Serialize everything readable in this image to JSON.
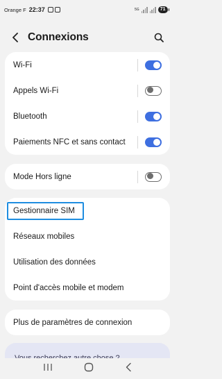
{
  "status_bar": {
    "carrier": "Orange F",
    "time": "22:37",
    "battery": "71",
    "network": "5G"
  },
  "header": {
    "title": "Connexions",
    "back_icon": "chevron-left-icon",
    "search_icon": "search-icon"
  },
  "group1": [
    {
      "label": "Wi-Fi",
      "toggle": "on"
    },
    {
      "label": "Appels Wi-Fi",
      "toggle": "off"
    },
    {
      "label": "Bluetooth",
      "toggle": "on"
    },
    {
      "label": "Paiements NFC et sans contact",
      "toggle": "on"
    }
  ],
  "group2": [
    {
      "label": "Mode Hors ligne",
      "toggle": "off"
    }
  ],
  "group3": [
    {
      "label": "Gestionnaire SIM"
    },
    {
      "label": "Réseaux mobiles"
    },
    {
      "label": "Utilisation des données"
    },
    {
      "label": "Point d'accès mobile et modem"
    }
  ],
  "group4": [
    {
      "label": "Plus de paramètres de connexion"
    }
  ],
  "partial_card": {
    "text": "Vous recherchez autre chose ?"
  },
  "nav_bar": {
    "recents_icon": "recents-icon",
    "home_icon": "home-icon",
    "back_icon": "back-triangle-icon"
  },
  "colors": {
    "accent": "#3e6fe0",
    "highlight_border": "#1e8de0",
    "background": "#f2f2f2"
  }
}
